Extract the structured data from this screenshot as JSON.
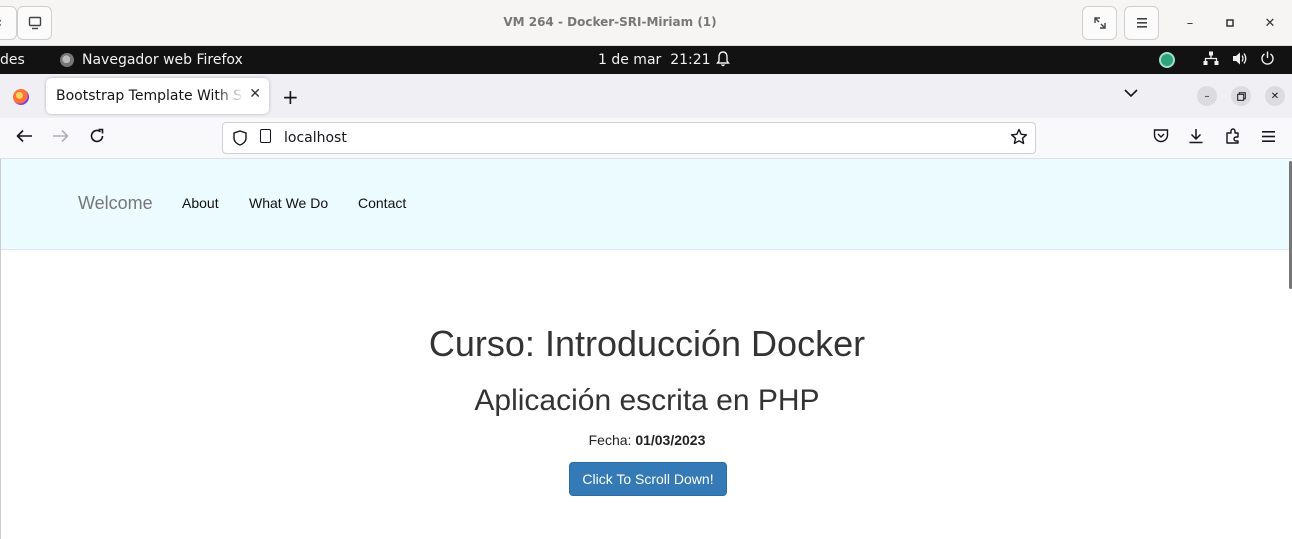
{
  "vm_window": {
    "title": "VM 264 - Docker-SRI-Miriam (1)"
  },
  "gnome_bar": {
    "activities": "des",
    "app_name": "Navegador web Firefox",
    "date": "1 de mar",
    "time": "21:21"
  },
  "browser": {
    "tab_title": "Bootstrap Template With Sticky Menu",
    "url": "localhost"
  },
  "site": {
    "brand": "Welcome",
    "nav": [
      "About",
      "What We Do",
      "Contact"
    ],
    "heading": "Curso: Introducción Docker",
    "subheading": "Aplicación escrita en PHP",
    "fecha_label": "Fecha:",
    "fecha_value": "01/03/2023",
    "button": "Click To Scroll Down!"
  },
  "colors": {
    "nav_bg": "#ebfbff",
    "button_bg": "#337ab7"
  },
  "icons": {
    "back": "arrow-left-icon",
    "forward": "arrow-right-icon",
    "reload": "reload-icon",
    "pocket": "pocket-icon",
    "download": "download-icon",
    "extensions": "extensions-icon",
    "menu": "hamburger-icon"
  }
}
